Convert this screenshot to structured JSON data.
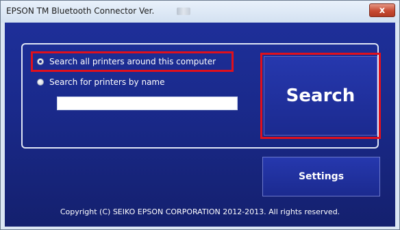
{
  "window": {
    "title": "EPSON TM Bluetooth Connector Ver.",
    "close_glyph": "x"
  },
  "search_options": [
    {
      "label": "Search all printers around this computer",
      "selected": true
    },
    {
      "label": "Search for printers by name",
      "selected": false
    }
  ],
  "name_input": {
    "value": "",
    "placeholder": ""
  },
  "buttons": {
    "search": "Search",
    "settings": "Settings"
  },
  "footer": {
    "copyright": "Copyright (C) SEIKO EPSON CORPORATION 2012-2013. All rights reserved."
  },
  "colors": {
    "background": "#1a2a8c",
    "highlight": "#e0101c"
  }
}
